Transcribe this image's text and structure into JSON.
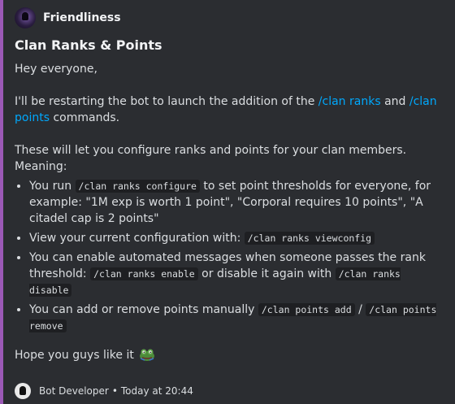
{
  "embed": {
    "accent_color": "#9b59b6",
    "author": {
      "name": "Friendliness",
      "icon": "avatar-icon"
    },
    "title": "Clan Ranks & Points",
    "description": {
      "greeting": "Hey everyone,",
      "announce_prefix": "I'll be restarting the bot to launch the addition of the ",
      "link_ranks": "/clan ranks",
      "and": " and ",
      "link_points": "/clan points",
      "announce_suffix": " commands.",
      "intro": "These will let you configure ranks and points for your clan members.",
      "meaning": "Meaning:",
      "bullets": {
        "b1_prefix": "You run ",
        "b1_code": "/clan ranks configure",
        "b1_suffix": " to set point thresholds for everyone, for example: \"1M exp is worth 1 point\", \"Corporal requires 10 points\", \"A citadel cap is 2 points\"",
        "b2_prefix": "View your current configuration with: ",
        "b2_code": "/clan ranks viewconfig",
        "b3_prefix": "You can enable automated messages when someone passes the rank threshold: ",
        "b3_code1": "/clan ranks enable",
        "b3_middle": " or disable it again with ",
        "b3_code2": "/clan ranks disable",
        "b4_prefix": "You can add or remove points manually ",
        "b4_code1": "/clan points add",
        "b4_sep": " / ",
        "b4_code2": "/clan points remove"
      },
      "closing": "Hope you guys like it",
      "closing_emoji": "frog-emoji"
    },
    "footer": {
      "icon": "bot-developer-icon",
      "text": "Bot Developer",
      "separator": "•",
      "timestamp": "Today at 20:44"
    }
  }
}
